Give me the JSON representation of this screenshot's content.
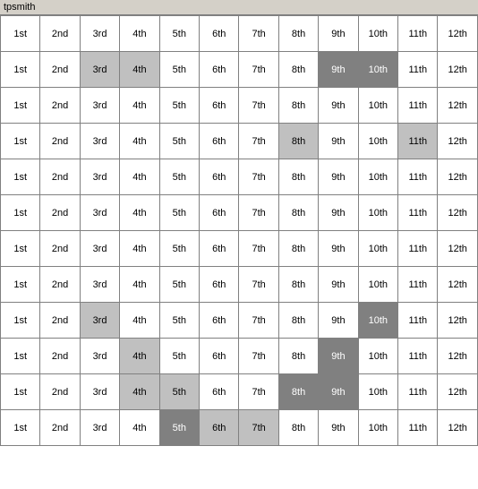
{
  "title": "tpsmith",
  "rows": [
    {
      "cells": [
        "1st",
        "2nd",
        "3rd",
        "4th",
        "5th",
        "6th",
        "7th",
        "8th",
        "9th",
        "10th",
        "11th",
        "12th"
      ],
      "highlights": [
        false,
        false,
        false,
        false,
        false,
        false,
        false,
        false,
        false,
        false,
        false,
        false
      ]
    },
    {
      "cells": [
        "1st",
        "2nd",
        "3rd",
        "4th",
        "5th",
        "6th",
        "7th",
        "8th",
        "9th",
        "10th",
        "11th",
        "12th"
      ],
      "highlights": [
        false,
        false,
        "light",
        "light",
        false,
        false,
        false,
        false,
        "dark",
        "dark",
        false,
        false
      ]
    },
    {
      "cells": [
        "1st",
        "2nd",
        "3rd",
        "4th",
        "5th",
        "6th",
        "7th",
        "8th",
        "9th",
        "10th",
        "11th",
        "12th"
      ],
      "highlights": [
        false,
        false,
        false,
        false,
        false,
        false,
        false,
        false,
        false,
        false,
        false,
        false
      ]
    },
    {
      "cells": [
        "1st",
        "2nd",
        "3rd",
        "4th",
        "5th",
        "6th",
        "7th",
        "8th",
        "9th",
        "10th",
        "11th",
        "12th"
      ],
      "highlights": [
        false,
        false,
        false,
        false,
        false,
        false,
        false,
        "light",
        false,
        false,
        "light",
        false
      ]
    },
    {
      "cells": [
        "1st",
        "2nd",
        "3rd",
        "4th",
        "5th",
        "6th",
        "7th",
        "8th",
        "9th",
        "10th",
        "11th",
        "12th"
      ],
      "highlights": [
        false,
        false,
        false,
        false,
        false,
        false,
        false,
        false,
        false,
        false,
        false,
        false
      ]
    },
    {
      "cells": [
        "1st",
        "2nd",
        "3rd",
        "4th",
        "5th",
        "6th",
        "7th",
        "8th",
        "9th",
        "10th",
        "11th",
        "12th"
      ],
      "highlights": [
        false,
        false,
        false,
        false,
        false,
        false,
        false,
        false,
        false,
        false,
        false,
        false
      ]
    },
    {
      "cells": [
        "1st",
        "2nd",
        "3rd",
        "4th",
        "5th",
        "6th",
        "7th",
        "8th",
        "9th",
        "10th",
        "11th",
        "12th"
      ],
      "highlights": [
        false,
        false,
        false,
        false,
        false,
        false,
        false,
        false,
        false,
        false,
        false,
        false
      ]
    },
    {
      "cells": [
        "1st",
        "2nd",
        "3rd",
        "4th",
        "5th",
        "6th",
        "7th",
        "8th",
        "9th",
        "10th",
        "11th",
        "12th"
      ],
      "highlights": [
        false,
        false,
        false,
        false,
        false,
        false,
        false,
        false,
        false,
        false,
        false,
        false
      ]
    },
    {
      "cells": [
        "1st",
        "2nd",
        "3rd",
        "4th",
        "5th",
        "6th",
        "7th",
        "8th",
        "9th",
        "10th",
        "11th",
        "12th"
      ],
      "highlights": [
        false,
        false,
        "light",
        false,
        false,
        false,
        false,
        false,
        false,
        "dark",
        false,
        false
      ]
    },
    {
      "cells": [
        "1st",
        "2nd",
        "3rd",
        "4th",
        "5th",
        "6th",
        "7th",
        "8th",
        "9th",
        "10th",
        "11th",
        "12th"
      ],
      "highlights": [
        false,
        false,
        false,
        "light",
        false,
        false,
        false,
        false,
        "dark",
        false,
        false,
        false
      ]
    },
    {
      "cells": [
        "1st",
        "2nd",
        "3rd",
        "4th",
        "5th",
        "6th",
        "7th",
        "8th",
        "9th",
        "10th",
        "11th",
        "12th"
      ],
      "highlights": [
        false,
        false,
        false,
        "light",
        "light",
        false,
        false,
        "dark",
        "dark",
        false,
        false,
        false
      ]
    },
    {
      "cells": [
        "1st",
        "2nd",
        "3rd",
        "4th",
        "5th",
        "6th",
        "7th",
        "8th",
        "9th",
        "10th",
        "11th",
        "12th"
      ],
      "highlights": [
        false,
        false,
        false,
        false,
        "dark",
        "light",
        "light",
        false,
        false,
        false,
        false,
        false
      ]
    }
  ]
}
